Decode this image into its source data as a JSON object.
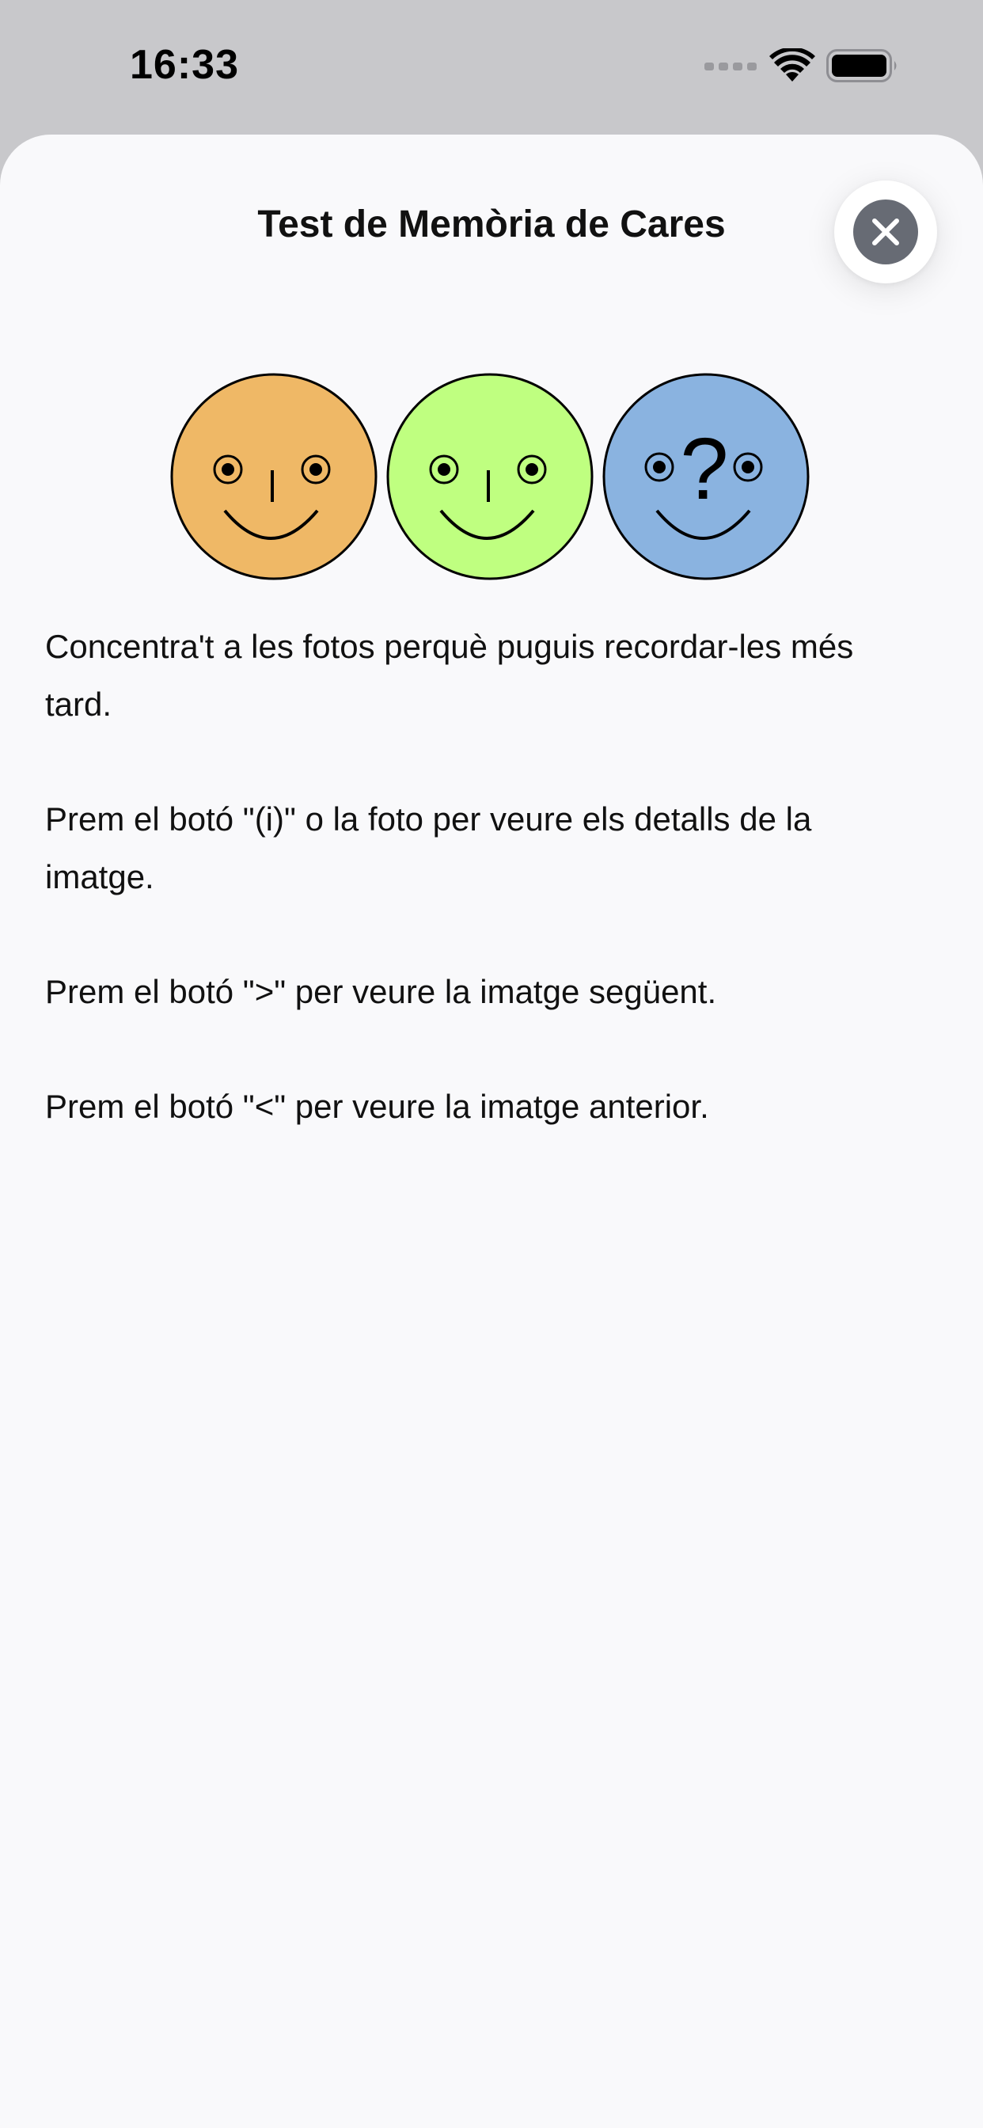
{
  "status_bar": {
    "time": "16:33",
    "icons": [
      "cellular-signal-icon",
      "wifi-icon",
      "battery-icon"
    ]
  },
  "sheet": {
    "title": "Test de Memòria de Cares",
    "close_icon": "close-icon"
  },
  "faces": [
    {
      "color": "#efb866",
      "feature": "nose"
    },
    {
      "color": "#bfff80",
      "feature": "nose"
    },
    {
      "color": "#8ab3e0",
      "feature": "?"
    }
  ],
  "instructions": [
    "Concentra't a les fotos perquè puguis recordar-les més tard.",
    "Prem el botó \"(i)\" o la foto per veure els detalls de la imatge.",
    "Prem el botó \">\" per veure la imatge següent.",
    "Prem el botó \"<\" per veure la imatge anterior."
  ],
  "colors": {
    "status_background": "#c8c8cb",
    "sheet_background": "#f9f9fb",
    "close_button_fill": "#676b74"
  }
}
